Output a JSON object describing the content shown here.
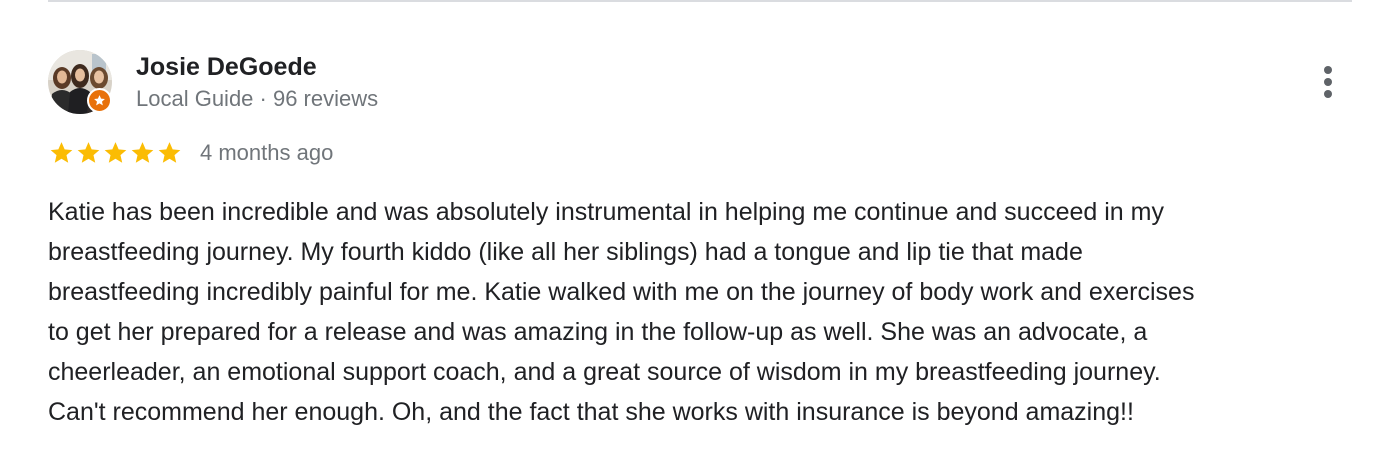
{
  "reviewer": {
    "name": "Josie DeGoede",
    "meta": "Local Guide · 96 reviews",
    "avatar_icon": "profile-photo-three-women",
    "badge_icon": "local-guide-star-icon"
  },
  "review": {
    "rating": 5,
    "rating_max": 5,
    "time": "4 months ago",
    "lines": [
      "Katie has been incredible and was absolutely instrumental in helping me continue and succeed in my",
      "breastfeeding journey. My fourth kiddo (like all her siblings) had a tongue and lip tie that made",
      "breastfeeding incredibly painful for me. Katie walked with me on the journey of body work and exercises",
      "to get her prepared for a release and was amazing in the follow-up as well. She was an advocate, a",
      "cheerleader, an emotional support coach, and a great source of wisdom in my breastfeeding journey.",
      "Can't recommend her enough. Oh, and the fact that she works with insurance is beyond amazing!!"
    ]
  },
  "actions": {
    "more_icon": "more-vertical-icon"
  },
  "colors": {
    "star": "#fbbc04",
    "text": "#202124",
    "secondary_text": "#70757a",
    "badge": "#e8710a",
    "divider": "#dadce0"
  }
}
